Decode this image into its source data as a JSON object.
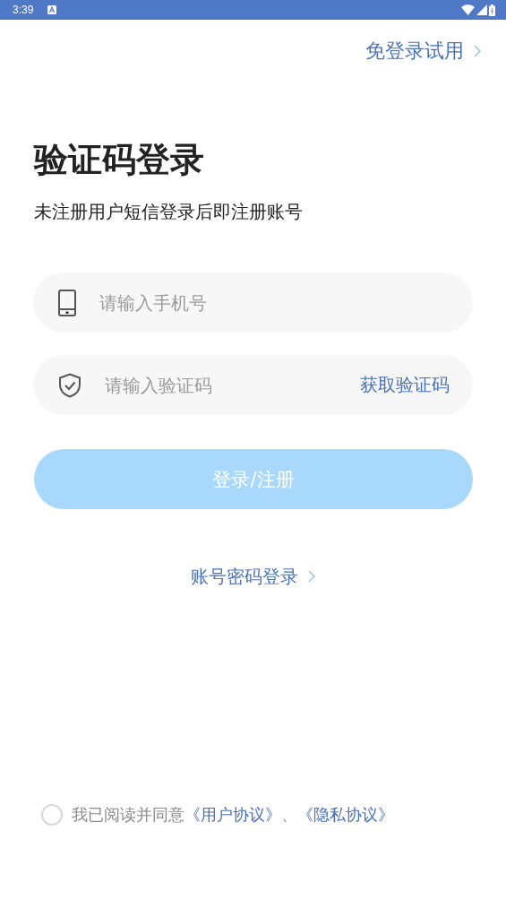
{
  "status_bar": {
    "time": "3:39"
  },
  "trial_link": {
    "label": "免登录试用"
  },
  "title": "验证码登录",
  "subtitle": "未注册用户短信登录后即注册账号",
  "phone_field": {
    "placeholder": "请输入手机号"
  },
  "code_field": {
    "placeholder": "请输入验证码",
    "action": "获取验证码"
  },
  "submit_button": {
    "label": "登录/注册",
    "disabled": true
  },
  "password_login_link": {
    "label": "账号密码登录"
  },
  "agreement": {
    "checked": false,
    "text": "我已阅读并同意",
    "links": [
      "《用户协议》",
      "《隐私协议》"
    ],
    "separator": "、"
  }
}
